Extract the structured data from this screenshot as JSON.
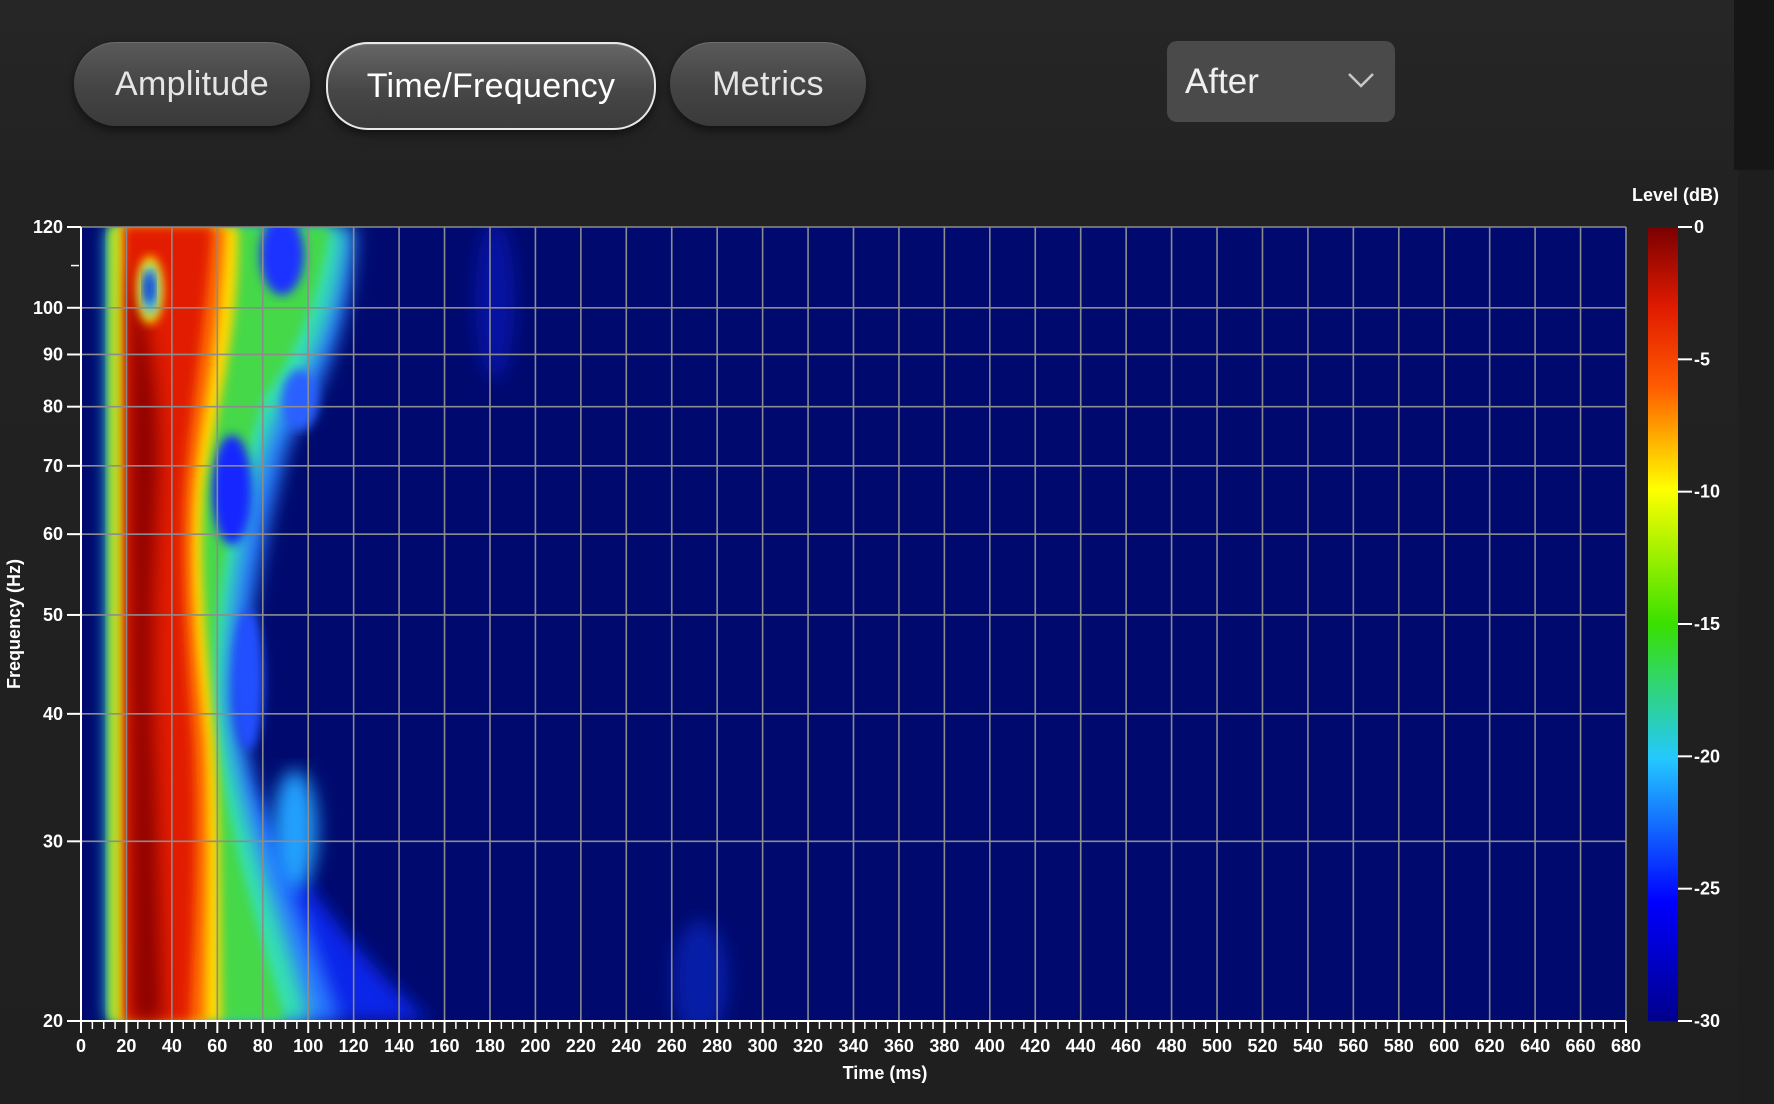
{
  "tabs": [
    {
      "label": "Amplitude",
      "active": false
    },
    {
      "label": "Time/Frequency",
      "active": true
    },
    {
      "label": "Metrics",
      "active": false
    }
  ],
  "view_select": {
    "value": "After"
  },
  "icons": {
    "dropdown": "chevron-down-icon"
  },
  "chart_data": {
    "type": "heatmap",
    "xlabel": "Time (ms)",
    "ylabel": "Frequency (Hz)",
    "colorbar_label": "Level (dB)",
    "xlim": [
      0,
      680
    ],
    "ylim": [
      20,
      120
    ],
    "y_scale": "log",
    "x_ticks": [
      0,
      20,
      40,
      60,
      80,
      100,
      120,
      140,
      160,
      180,
      200,
      220,
      240,
      260,
      280,
      300,
      320,
      340,
      360,
      380,
      400,
      420,
      440,
      460,
      480,
      500,
      520,
      540,
      560,
      580,
      600,
      620,
      640,
      660,
      680
    ],
    "y_ticks": [
      20,
      30,
      40,
      50,
      60,
      70,
      80,
      90,
      100,
      120
    ],
    "colorbar_ticks": [
      0,
      -5,
      -10,
      -15,
      -20,
      -25,
      -30
    ],
    "color_range": [
      -30,
      0
    ],
    "grid": true,
    "colors": {
      "background": "#000a6e",
      "grid": "#8c8c8c",
      "axis": "#ffffff"
    },
    "features": [
      {
        "time_ms": [
          12,
          18
        ],
        "freq_hz": [
          20,
          120
        ],
        "level_db": -14,
        "shape": "onset band"
      },
      {
        "time_ms": [
          18,
          60
        ],
        "freq_hz": [
          20,
          120
        ],
        "level_db": -1,
        "shape": "main energy ridge"
      },
      {
        "time_ms": [
          55,
          120
        ],
        "freq_hz": [
          20,
          120
        ],
        "level_db": -15,
        "shape": "decay tail"
      },
      {
        "time_ms": [
          100,
          160
        ],
        "freq_hz": [
          20,
          35
        ],
        "level_db": -24,
        "shape": "low frequency tail"
      },
      {
        "time_ms": [
          270,
          290
        ],
        "freq_hz": [
          20,
          28
        ],
        "level_db": -26,
        "shape": "minor blob"
      }
    ]
  }
}
